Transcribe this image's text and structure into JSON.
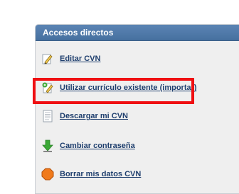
{
  "panel": {
    "title": "Accesos directos",
    "items": [
      {
        "label": "Editar CVN",
        "icon": "pencil-icon"
      },
      {
        "label": "Utilizar currículo existente (importar)",
        "icon": "import-document-icon"
      },
      {
        "label": "Descargar mi CVN",
        "icon": "document-icon"
      },
      {
        "label": "Cambiar contraseña",
        "icon": "down-arrow-icon"
      },
      {
        "label": "Borrar mis datos CVN",
        "icon": "stop-octagon-icon"
      }
    ]
  },
  "colors": {
    "header": "#4d77a7",
    "link": "#1f3f6e",
    "highlight": "#ef0f12",
    "stop": "#f07a1c",
    "arrow": "#3aa835"
  }
}
